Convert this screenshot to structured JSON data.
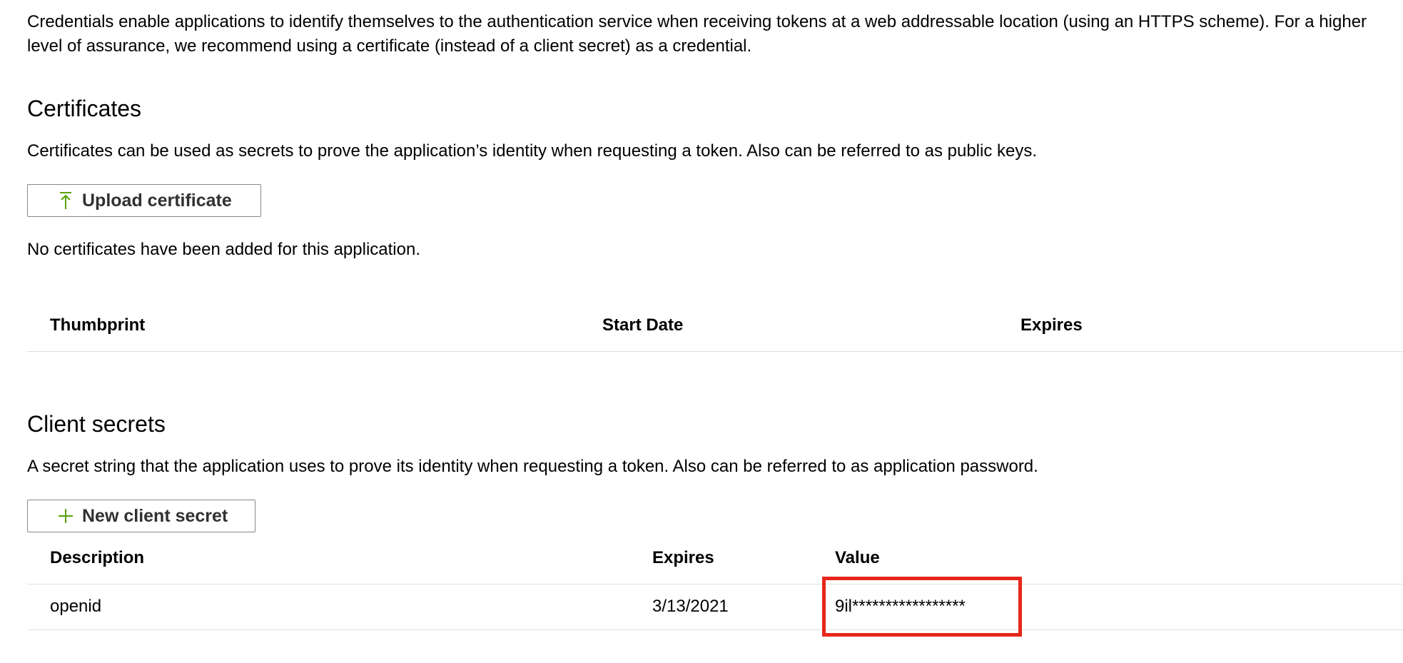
{
  "intro": {
    "text": "Credentials enable applications to identify themselves to the authentication service when receiving tokens at a web addressable location (using an HTTPS scheme). For a higher level of assurance, we recommend using a certificate (instead of a client secret) as a credential."
  },
  "certificates": {
    "title": "Certificates",
    "description": "Certificates can be used as secrets to prove the application’s identity when requesting a token. Also can be referred to as public keys.",
    "upload_button": {
      "label": "Upload certificate",
      "icon": "upload-icon"
    },
    "empty_message": "No certificates have been added for this application.",
    "columns": [
      "Thumbprint",
      "Start Date",
      "Expires"
    ]
  },
  "client_secrets": {
    "title": "Client secrets",
    "description": "A secret string that the application uses to prove its identity when requesting a token. Also can be referred to as application password.",
    "new_button": {
      "label": "New client secret",
      "icon": "plus-icon"
    },
    "columns": [
      "Description",
      "Expires",
      "Value"
    ],
    "rows": [
      {
        "description": "openid",
        "expires": "3/13/2021",
        "value": "9il*****************"
      }
    ]
  },
  "colors": {
    "accent_icon": "#57a300",
    "highlight_border": "#e8261a",
    "divider": "#e1dfdd"
  }
}
